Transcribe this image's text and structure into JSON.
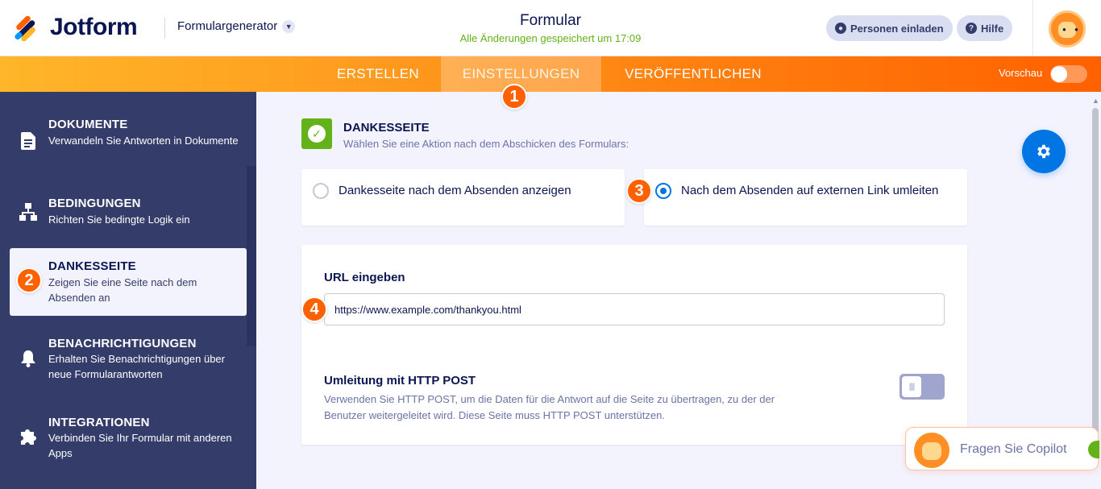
{
  "header": {
    "logo_text": "Jotform",
    "builder_menu": "Formulargenerator",
    "form_title": "Formular",
    "save_status": "Alle Änderungen gespeichert um 17:09",
    "invite_label": "Personen einladen",
    "help_label": "Hilfe"
  },
  "nav": {
    "tabs": [
      {
        "label": "ERSTELLEN"
      },
      {
        "label": "EINSTELLUNGEN"
      },
      {
        "label": "VERÖFFENTLICHEN"
      }
    ],
    "active_tab": "EINSTELLUNGEN",
    "preview_label": "Vorschau",
    "preview_on": false
  },
  "badges": [
    "1",
    "2",
    "3",
    "4"
  ],
  "sidebar": {
    "items": [
      {
        "title": "DOKUMENTE",
        "desc": "Verwandeln Sie Antworten in Dokumente",
        "icon": "document-icon"
      },
      {
        "title": "BEDINGUNGEN",
        "desc": "Richten Sie bedingte Logik ein",
        "icon": "conditions-icon"
      },
      {
        "title": "DANKESSEITE",
        "desc": "Zeigen Sie eine Seite nach dem Absenden an",
        "icon": "thankyou-icon",
        "active": true
      },
      {
        "title": "BENACHRICHTIGUNGEN",
        "desc": "Erhalten Sie Benachrichtigungen über neue Formularantworten",
        "icon": "bell-icon"
      },
      {
        "title": "INTEGRATIONEN",
        "desc": "Verbinden Sie Ihr Formular mit anderen Apps",
        "icon": "puzzle-icon"
      }
    ]
  },
  "thankyou": {
    "title": "DANKESSEITE",
    "desc": "Wählen Sie eine Aktion nach dem Abschicken des Formulars:",
    "option_1": "Dankesseite nach dem Absenden anzeigen",
    "option_2": "Nach dem Absenden auf externen Link umleiten",
    "selected_option": 2,
    "url_label": "URL eingeben",
    "url_value": "https://www.example.com/thankyou.html",
    "post_label": "Umleitung mit HTTP POST",
    "post_desc": "Verwenden Sie HTTP POST, um die Daten für die Antwort auf die Seite zu übertragen, zu der der Benutzer weitergeleitet wird. Diese Seite muss HTTP POST unterstützen.",
    "post_enabled": false
  },
  "copilot": {
    "label": "Fragen Sie Copilot"
  },
  "colors": {
    "accent_orange": "#ff6100",
    "sidebar_bg": "#343c6a",
    "primary_blue": "#0075e3",
    "success_green": "#64b21a"
  }
}
